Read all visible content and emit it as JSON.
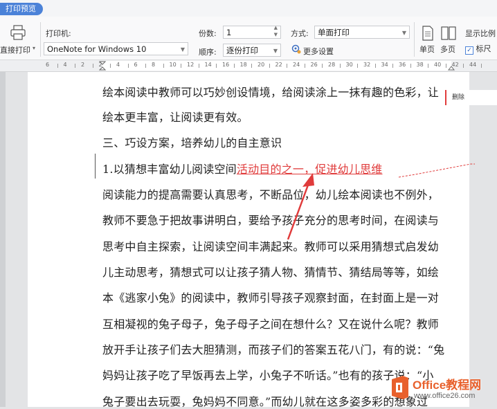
{
  "tab": {
    "label": "打印预览"
  },
  "toolbar": {
    "direct_print_label": "直接打印",
    "printer_label": "打印机:",
    "printer_value": "OneNote for Windows 10",
    "copies_label": "份数:",
    "copies_value": "1",
    "order_label": "顺序:",
    "order_value": "逐份打印",
    "mode_label": "方式:",
    "mode_value": "单面打印",
    "more_settings_label": "更多设置",
    "single_page_label": "单页",
    "multi_page_label": "多页",
    "display_ratio_label": "显示比例",
    "ruler_checkbox_label": "标尺",
    "ruler_checked": true
  },
  "ruler": {
    "numbers": [
      "6",
      "4",
      "2",
      "2",
      "4",
      "6",
      "8",
      "10",
      "12",
      "14",
      "16",
      "18",
      "20",
      "22",
      "24",
      "26",
      "28",
      "30",
      "32",
      "34",
      "36",
      "38",
      "40",
      "42",
      "44"
    ]
  },
  "document": {
    "line1": "绘本阅读中教师可以巧妙创设情境，给阅读涂上一抹有趣的色彩，让",
    "line2": "绘本更丰富，让阅读更有效。",
    "line3": "三、巧设方案，培养幼儿的自主意识",
    "line4_black": "1.以猜想丰富幼儿阅读空间",
    "line4_red": "活动目的之一，促进幼儿思维",
    "line5": "阅读能力的提高需要认真思考，不断品位，幼儿绘本阅读也不例外，",
    "line6": "教师不要急于把故事讲明白，要给予孩子充分的思考时间，在阅读与",
    "line7": "思考中自主探索，让阅读空间丰满起来。教师可以采用猜想式启发幼",
    "line8": "儿主动思考，猜想式可以让孩子猜人物、猜情节、猜结局等等，如绘",
    "line9": "本《逃家小兔》的阅读中，教师引导孩子观察封面，在封面上是一对",
    "line10": "互相凝视的兔子母子，兔子母子之间在想什么？又在说什么呢？教师",
    "line11": "放开手让孩子们去大胆猜测，而孩子们的答案五花八门，有的说：“兔",
    "line12": "妈妈让孩子吃了早饭再去上学，小兔子不听话。”也有的孩子说：“小",
    "line13": "兔子要出去玩耍，兔妈妈不同意。”而幼儿就在这多姿多彩的想象过"
  },
  "comment": {
    "label": "删除"
  },
  "watermark": {
    "brand": "Office教程网",
    "url": "www.office26.com"
  },
  "colors": {
    "accent": "#4b82d8",
    "revision_red": "#e03b3b"
  }
}
